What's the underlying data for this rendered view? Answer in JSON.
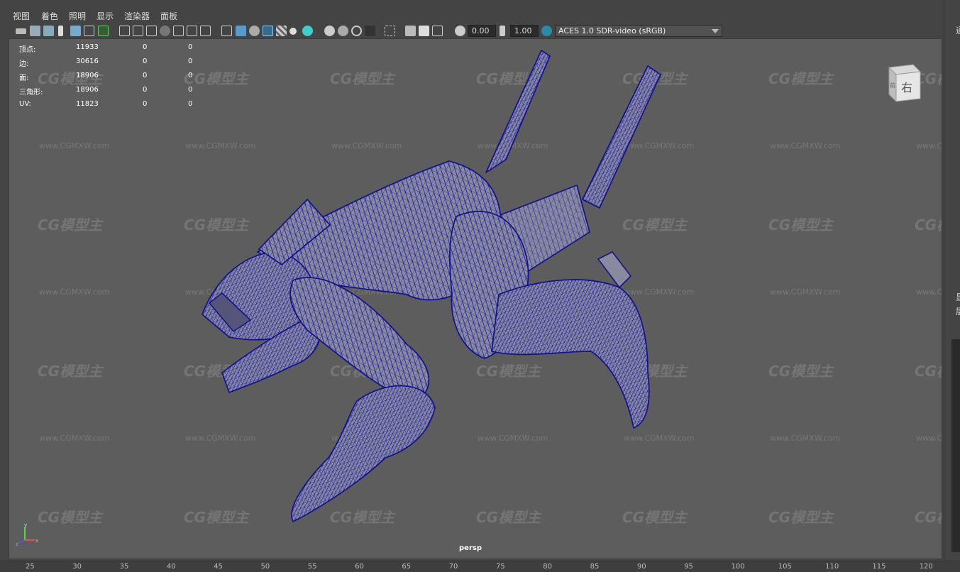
{
  "menu": [
    "视图",
    "着色",
    "照明",
    "显示",
    "渲染器",
    "面板"
  ],
  "toolbar": {
    "exposure": "0.00",
    "gamma": "1.00",
    "color_space": "ACES 1.0 SDR-video (sRGB)"
  },
  "hud": {
    "rows": [
      {
        "label": "顶点:",
        "v1": "11933",
        "v2": "0",
        "v3": "0"
      },
      {
        "label": "边:",
        "v1": "30616",
        "v2": "0",
        "v3": "0"
      },
      {
        "label": "面:",
        "v1": "18906",
        "v2": "0",
        "v3": "0"
      },
      {
        "label": "三角形:",
        "v1": "18906",
        "v2": "0",
        "v3": "0"
      },
      {
        "label": "UV:",
        "v1": "11823",
        "v2": "0",
        "v3": "0"
      }
    ]
  },
  "viewport": {
    "camera": "persp",
    "viewcube_face": "右",
    "viewcube_side": "前",
    "axis_x": "x",
    "axis_y": "y",
    "axis_z": "z",
    "watermark_logo": "CG模型主",
    "watermark_url": "www.CGMXW.com"
  },
  "ruler": [
    "25",
    "30",
    "35",
    "40",
    "45",
    "50",
    "55",
    "60",
    "65",
    "70",
    "75",
    "80",
    "85",
    "90",
    "95",
    "100",
    "105",
    "110",
    "115",
    "120"
  ],
  "right_panel": {
    "t1": "通",
    "t2": "显",
    "t3": "层"
  },
  "colors": {
    "wire": "#1a1aa6",
    "fill": "#8a8a9e",
    "viewport_bg": "#5d5d5d"
  }
}
